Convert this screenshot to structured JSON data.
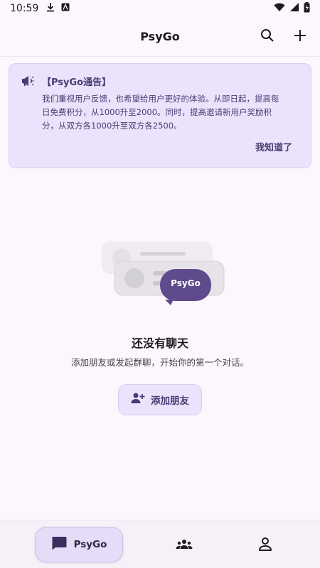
{
  "status_bar": {
    "time": "10:59"
  },
  "app_bar": {
    "title": "PsyGo"
  },
  "notice": {
    "title": "【PsyGo通告】",
    "body_lines": [
      "我们重视用户反馈，也希望给用户更好的体验。从即日起，提高每",
      "日免费积分，从1000升至2000。同时，提高邀请新用户奖励积",
      "分，从双方各1000升至双方各2500。"
    ],
    "ack_label": "我知道了"
  },
  "illustration": {
    "badge_text": "PsyGo"
  },
  "empty_state": {
    "title": "还没有聊天",
    "subtitle": "添加朋友或发起群聊，开始你的第一个对话。",
    "add_friend_label": "添加朋友"
  },
  "bottom_nav": {
    "chats_label": "PsyGo"
  },
  "colors": {
    "accent": "#5f4b8b",
    "accent_container": "#ebe3fb",
    "background": "#fcf7fc"
  }
}
